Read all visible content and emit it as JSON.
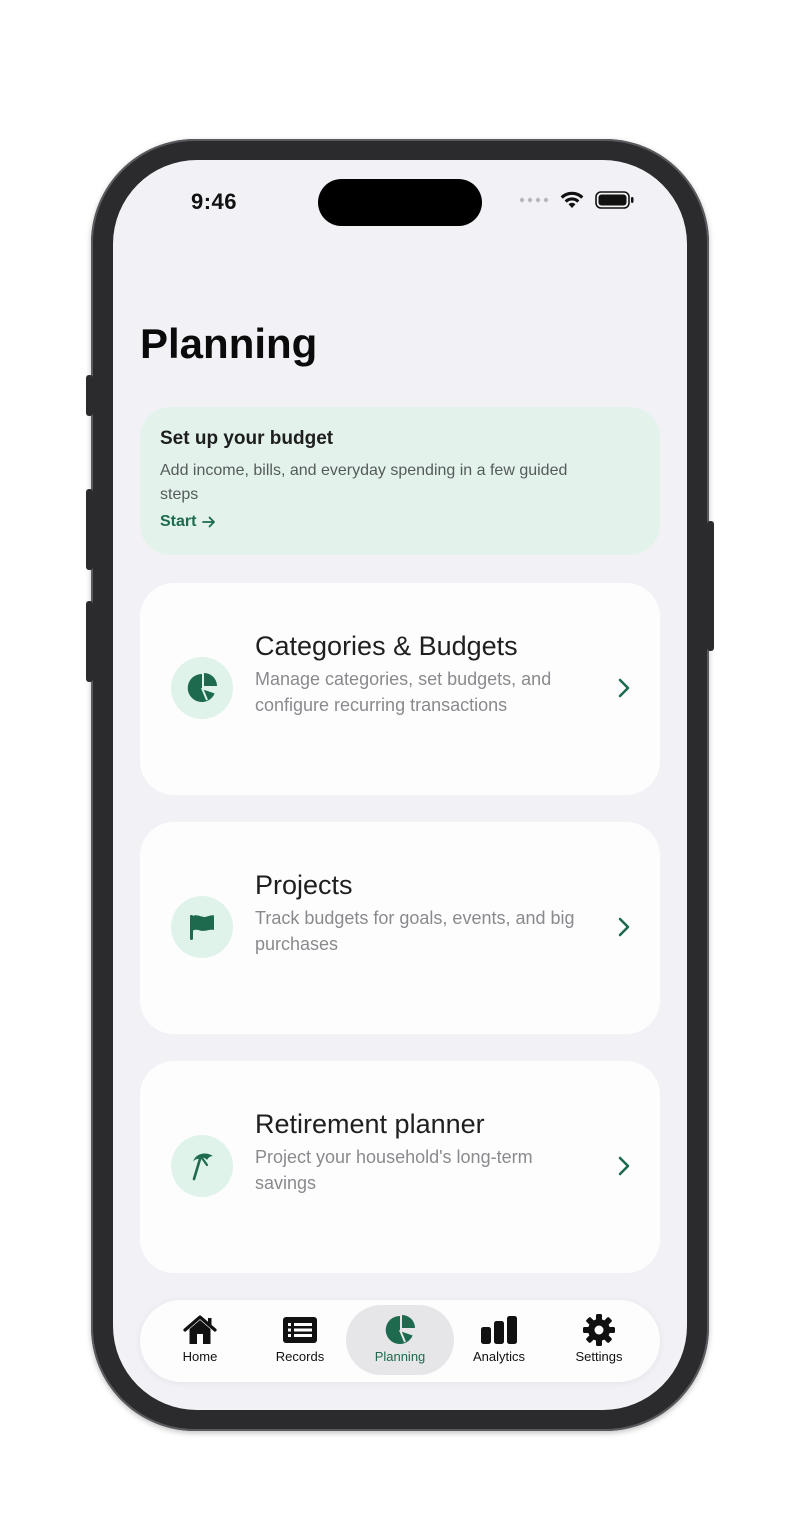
{
  "status_bar": {
    "time": "9:46"
  },
  "page": {
    "title": "Planning"
  },
  "banner": {
    "title": "Set up your budget",
    "description": "Add income, bills, and everyday spending in a few guided steps",
    "start_label": "Start"
  },
  "cards": [
    {
      "title": "Categories & Budgets",
      "description": "Manage categories, set budgets, and configure recurring transactions",
      "icon": "pie-chart-icon"
    },
    {
      "title": "Projects",
      "description": "Track budgets for goals, events, and big purchases",
      "icon": "flag-icon"
    },
    {
      "title": "Retirement planner",
      "description": "Project your household's long-term savings",
      "icon": "beach-umbrella-icon"
    }
  ],
  "tabs": [
    {
      "label": "Home",
      "icon": "house-icon",
      "active": false
    },
    {
      "label": "Records",
      "icon": "list-icon",
      "active": false
    },
    {
      "label": "Planning",
      "icon": "pie-chart-icon",
      "active": true
    },
    {
      "label": "Analytics",
      "icon": "bar-chart-icon",
      "active": false
    },
    {
      "label": "Settings",
      "icon": "gear-icon",
      "active": false
    }
  ],
  "colors": {
    "accent": "#1d6a4e",
    "banner_bg": "#e3f3ec",
    "icon_bg": "#dff3ea",
    "screen_bg": "#f2f2f6"
  }
}
